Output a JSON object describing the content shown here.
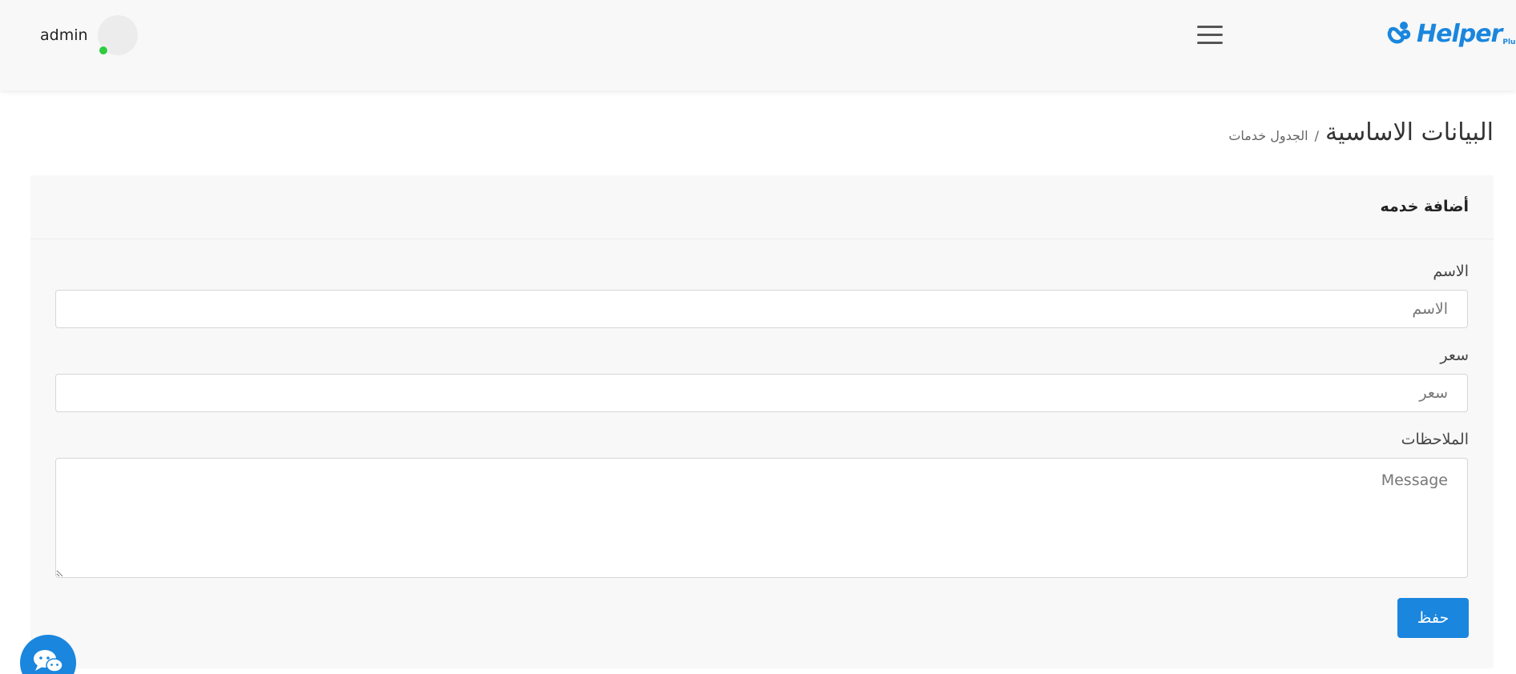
{
  "header": {
    "user_name": "admin",
    "logo_text": "Helper",
    "logo_sub": "Plus",
    "brand_color": "#1a86de",
    "online_color": "#2ecc40",
    "menu_icon": "hamburger-menu-icon"
  },
  "page": {
    "title": "البيانات الاساسية",
    "breadcrumb_sep": "/",
    "breadcrumb": "الجدول خدمات"
  },
  "form": {
    "card_title": "أضافة خدمه",
    "name_label": "الاسم",
    "name_placeholder": "الاسم",
    "name_value": "",
    "price_label": "سعر",
    "price_placeholder": "سعر",
    "price_value": "",
    "notes_label": "الملاحظات",
    "notes_placeholder": "Message",
    "notes_value": "",
    "save_label": "حفظ"
  },
  "chat": {
    "icon": "chat-bubbles-icon"
  }
}
